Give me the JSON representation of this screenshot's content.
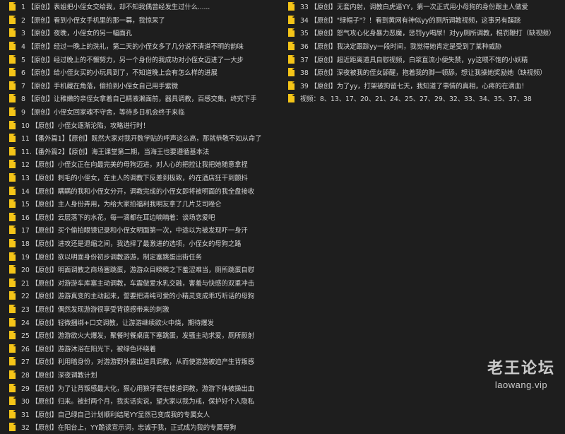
{
  "left_items": [
    "1 【原创】表姐把小侄女交给我，却不知我偶曾经发生过什么......",
    "2 【原创】看到小侄女手机里的那一幕，我惊呆了",
    "3 【原创】夜晚，小侄女的另一幅面孔",
    "4 【原创】经过一晚上的洗礼，第二天的小侄女多了几分说不清道不明的韵味",
    "5 【原创】经过晚上的不懈努力，另一个身份的我成功对小侄女迈进了一大步",
    "6 【原创】给小侄女买的小玩具到了，不知道晚上会有怎么样的进展",
    "7 【原创】手机藏在角落，偷拍到小侄女自己用手紫微",
    "8 【原创】让稚嫩的亲侄女拿着自己精液濑面前，器具调教，百感交集，终究下手",
    "9 【原创】小侄女回家魂不守舍，等待多日机会终于来临",
    "10 【原创】小侄女逐渐沦陷，攻略进行时！",
    "11 【番外篇1】【原创】既然大家对我开数学贴的呼声这么高，那就恭敬不如从命了",
    "11.【番外篇2】【原创】海王课堂第二期，当海王也要遵循基本法",
    "12 【原创】小侄女正在向最完美的母狗迈进，对人心的把控让我把她随意拿捏",
    "13 【原创】刺毛的小侄女，在主人的调教下反差到极致，约在酒店狂干到颤抖",
    "14 【原创】瞒瞒的我和小侄女分开，调教完成的小侄女即将被明面的我全盘接收",
    "15 【原创】主人身份弄用，为给大家拍福利我明友拿了几片艾司唑仑",
    "16 【原创】云层落下的水花，每一滴都在耳边喃喃着：谈场恋爱吧",
    "17 【原创】买个偷拍眼镜记录和小侄女明面第一次，中途以为被发现吓一身汗",
    "18 【原创】进攻还是退缩之间，我选择了最激进的选项，小侄女的母狗之路",
    "19 【原创】欲以明面身份初步调教游游，制定塞跳蛋出街任务",
    "20 【原创】明面调教之商场塞跳蛋，游游众目睽睽之下羞涩难当，厕所跳蛋自慰",
    "21 【原创】对游游车库塞主动调教，车震做爱水乳交融，害羞与快感的双重冲击",
    "22 【原创】游游真变的主动起来，誓要把清纯可爱的小精灵变成乖巧听话的母狗",
    "23 【原创】偶然发现游游很享受背德感带来的刺激",
    "24 【原创】轻微捆绑+口交调教，让游游继续欲火中烧，期待爆发",
    "25 【原创】游游欲火大爆发，聚餐时餐桌底下塞跳蛋，发骚主动求爱，厕所颜射",
    "26 【原创】游游沐浴在阳光下，被绿色环绕着",
    "27 【原创】利用暗身份，对游游野外露出道具调教，从而使游游被迫产生背叛感",
    "28 【原创】深夜调教计划",
    "29 【原创】为了让背叛感最大化，狠心用狼牙套在楼道调教，游游下体被操出血",
    "30 【原创】归来。被封两个月，我实话实说，望大家以我为戒，保护好个人隐私",
    "31 【原创】自己绿自己计划顺利结尾YY显然已变成我的专属女人",
    "32 【原创】在阳台上，YY跪读宣示词，忠诚于我，正式成为我的专属母狗"
  ],
  "right_items": [
    "33 【原创】无套内射，调教白虎逼YY，第一次正式用小母狗的身份跟主人做爱",
    "34 【原创】\"绿帽子\"？！看到黄网有神似yy的厕所调教视频，这事另有蹊跷",
    "35 【原创】怒气攻心化身暴力恶魔，惩罚yy喝尿！对yy厕所调教，棍罚鞭打（缺视频）",
    "36 【原创】我决定跟踪yy一段时间，我觉得她肯定是受到了某种威胁",
    "37 【原创】超近距离道具自慰视频，白浆直流小便失禁，yy这喂不饱的小妖精",
    "38 【原创】深夜被我的侄女舔醒，抱着我的脚一顿舔，想让我操她奖励她（缺视频）",
    "39 【原创】为了yy，打架被拘留七天，我知道了事情的真相，心疼的在滴血！",
    "视频：8、13、17、20、21、24、25、27、29、32、33、34、35、37、38"
  ],
  "watermark": {
    "text_cn": "老王论坛",
    "text_en": "laowang.vip"
  },
  "colors": {
    "background": "#1e1e1e",
    "text": "#d4d4d4",
    "icon": "#f5c518"
  }
}
